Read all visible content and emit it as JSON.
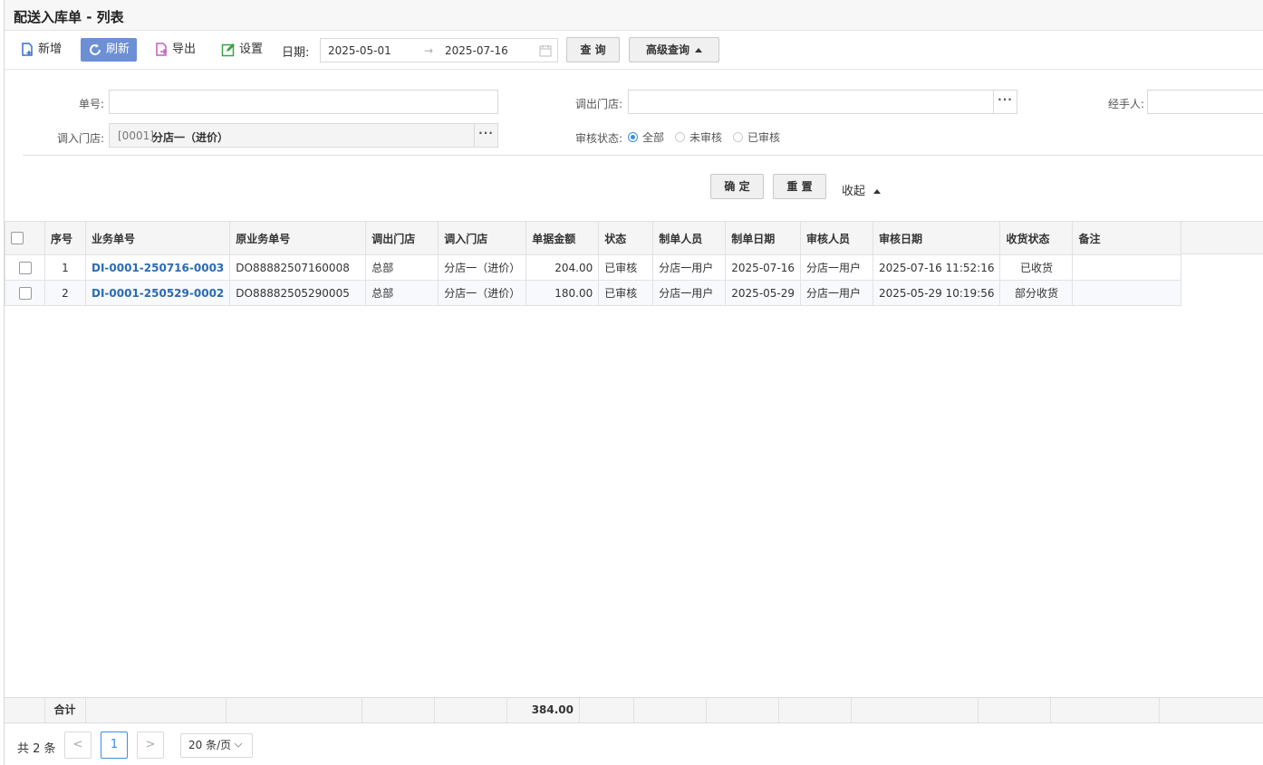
{
  "title": "配送入库单 - 列表",
  "toolbar": {
    "add": "新增",
    "refresh": "刷新",
    "export": "导出",
    "settings": "设置",
    "date_label": "日期:",
    "date_from": "2025-05-01",
    "date_arrow": "→",
    "date_to": "2025-07-16",
    "query": "查 询",
    "advanced": "高级查询"
  },
  "filter": {
    "order_no_label": "单号:",
    "order_no_value": "",
    "out_store_label": "调出门店:",
    "out_store_value": "",
    "handler_label": "经手人:",
    "handler_value": "",
    "in_store_label": "调入门店:",
    "in_store_code": "[0001]",
    "in_store_name": "分店一（进价）",
    "dots": "···",
    "audit_label": "审核状态:",
    "audit_options": [
      "全部",
      "未审核",
      "已审核"
    ],
    "audit_selected": "全部",
    "confirm": "确 定",
    "reset": "重 置",
    "collapse": "收起"
  },
  "table": {
    "columns": [
      "序号",
      "业务单号",
      "原业务单号",
      "调出门店",
      "调入门店",
      "单据金额",
      "状态",
      "制单人员",
      "制单日期",
      "审核人员",
      "审核日期",
      "收货状态",
      "备注"
    ],
    "rows": [
      {
        "seq": "1",
        "bill_no": "DI-0001-250716-0003",
        "orig_no": "DO88882507160008",
        "out_store": "总部",
        "in_store": "分店一（进价）",
        "amount": "204.00",
        "status": "已审核",
        "maker": "分店一用户",
        "make_date": "2025-07-16",
        "auditor": "分店一用户",
        "audit_date": "2025-07-16 11:52:16",
        "recv_status": "已收货",
        "remark": ""
      },
      {
        "seq": "2",
        "bill_no": "DI-0001-250529-0002",
        "orig_no": "DO88882505290005",
        "out_store": "总部",
        "in_store": "分店一（进价）",
        "amount": "180.00",
        "status": "已审核",
        "maker": "分店一用户",
        "make_date": "2025-05-29",
        "auditor": "分店一用户",
        "audit_date": "2025-05-29 10:19:56",
        "recv_status": "部分收货",
        "remark": ""
      }
    ],
    "footer_label": "合计",
    "footer_amount": "384.00"
  },
  "pager": {
    "total": "共 2 条",
    "prev": "<",
    "current": "1",
    "next": ">",
    "page_size": "20 条/页"
  },
  "colors": {
    "accent": "#6c8fd6",
    "link": "#2a6bb5",
    "radio": "#3c8de0"
  }
}
